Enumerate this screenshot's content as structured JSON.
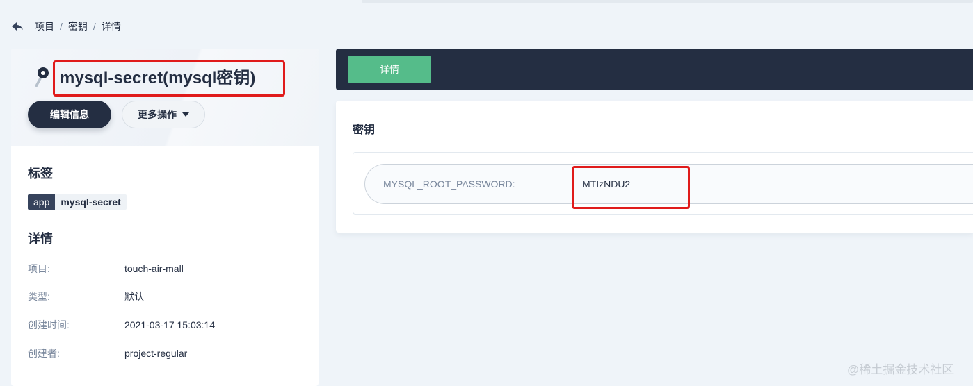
{
  "breadcrumb": {
    "items": [
      "项目",
      "密钥",
      "详情"
    ],
    "separator": "/"
  },
  "resource": {
    "title": "mysql-secret(mysql密钥)",
    "edit_button": "编辑信息",
    "more_button": "更多操作"
  },
  "labels": {
    "title": "标签",
    "tag_key": "app",
    "tag_value": "mysql-secret"
  },
  "details": {
    "title": "详情",
    "rows": [
      {
        "label": "项目:",
        "value": "touch-air-mall"
      },
      {
        "label": "类型:",
        "value": "默认"
      },
      {
        "label": "创建时间:",
        "value": "2021-03-17 15:03:14"
      },
      {
        "label": "创建者:",
        "value": "project-regular"
      }
    ]
  },
  "tabs": {
    "active": "详情"
  },
  "secret": {
    "title": "密钥",
    "entries": [
      {
        "key": "MYSQL_ROOT_PASSWORD:",
        "value": "MTIzNDU2"
      }
    ]
  },
  "watermark": "@稀土掘金技术社区",
  "colors": {
    "accent": "#55bc8a",
    "dark": "#242e42",
    "highlight": "#e01b1b"
  }
}
